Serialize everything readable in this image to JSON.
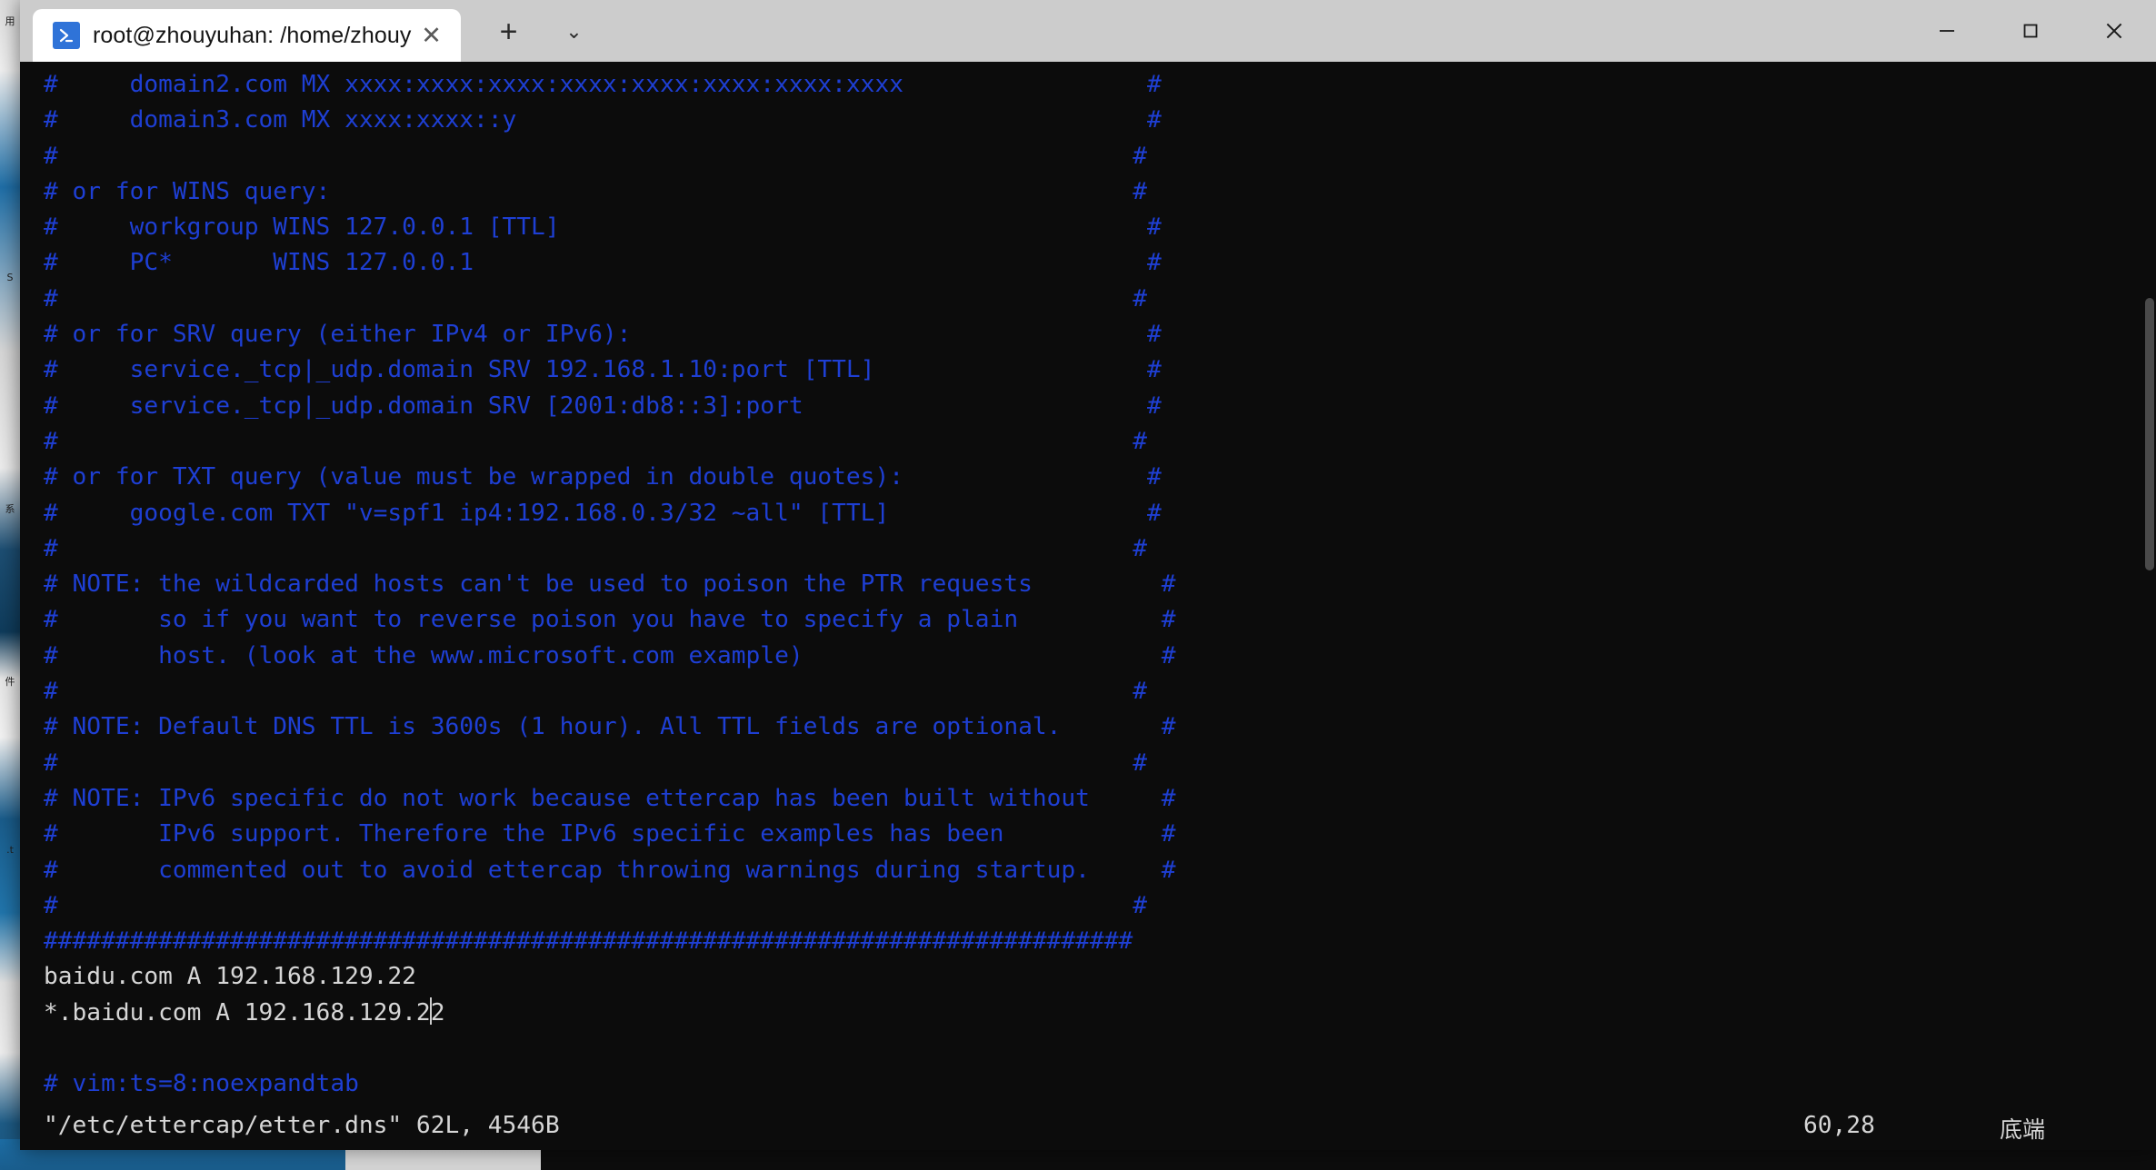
{
  "window": {
    "tab": {
      "title": "root@zhouyuhan: /home/zhouy",
      "icon": "powershell-icon",
      "close_label": "✕"
    },
    "newtab_label": "+",
    "dropdown_label": "⌄",
    "controls": {
      "minimize_label": "─",
      "maximize_label": "□",
      "close_label": "✕"
    }
  },
  "terminal": {
    "fg_comment": "#1e3fd4",
    "fg_text": "#d6d6d6",
    "background": "#0c0c0c",
    "lines": [
      {
        "text": "#     domain2.com MX xxxx:xxxx:xxxx:xxxx:xxxx:xxxx:xxxx:xxxx                 #",
        "style": "comment"
      },
      {
        "text": "#     domain3.com MX xxxx:xxxx::y                                            #",
        "style": "comment"
      },
      {
        "text": "#                                                                           #",
        "style": "comment"
      },
      {
        "text": "# or for WINS query:                                                        #",
        "style": "comment"
      },
      {
        "text": "#     workgroup WINS 127.0.0.1 [TTL]                                         #",
        "style": "comment"
      },
      {
        "text": "#     PC*       WINS 127.0.0.1                                               #",
        "style": "comment"
      },
      {
        "text": "#                                                                           #",
        "style": "comment"
      },
      {
        "text": "# or for SRV query (either IPv4 or IPv6):                                    #",
        "style": "comment"
      },
      {
        "text": "#     service._tcp|_udp.domain SRV 192.168.1.10:port [TTL]                   #",
        "style": "comment"
      },
      {
        "text": "#     service._tcp|_udp.domain SRV [2001:db8::3]:port                        #",
        "style": "comment"
      },
      {
        "text": "#                                                                           #",
        "style": "comment"
      },
      {
        "text": "# or for TXT query (value must be wrapped in double quotes):                 #",
        "style": "comment"
      },
      {
        "text": "#     google.com TXT \"v=spf1 ip4:192.168.0.3/32 ~all\" [TTL]                  #",
        "style": "comment"
      },
      {
        "text": "#                                                                           #",
        "style": "comment"
      },
      {
        "text": "# NOTE: the wildcarded hosts can't be used to poison the PTR requests         #",
        "style": "comment"
      },
      {
        "text": "#       so if you want to reverse poison you have to specify a plain          #",
        "style": "comment"
      },
      {
        "text": "#       host. (look at the www.microsoft.com example)                         #",
        "style": "comment"
      },
      {
        "text": "#                                                                           #",
        "style": "comment"
      },
      {
        "text": "# NOTE: Default DNS TTL is 3600s (1 hour). All TTL fields are optional.       #",
        "style": "comment"
      },
      {
        "text": "#                                                                           #",
        "style": "comment"
      },
      {
        "text": "# NOTE: IPv6 specific do not work because ettercap has been built without     #",
        "style": "comment"
      },
      {
        "text": "#       IPv6 support. Therefore the IPv6 specific examples has been           #",
        "style": "comment"
      },
      {
        "text": "#       commented out to avoid ettercap throwing warnings during startup.     #",
        "style": "comment"
      },
      {
        "text": "#                                                                           #",
        "style": "comment"
      },
      {
        "text": "############################################################################",
        "style": "comment"
      },
      {
        "text": "baidu.com A 192.168.129.22",
        "style": "text"
      },
      {
        "text": "*.baidu.com A 192.168.129.2|2",
        "style": "text-cursor"
      },
      {
        "text": "",
        "style": "text"
      },
      {
        "text": "# vim:ts=8:noexpandtab",
        "style": "comment"
      }
    ],
    "statusline": {
      "file": "\"/etc/ettercap/etter.dns\" 62L, 4546B",
      "position": "60,28",
      "mode": "底端"
    }
  },
  "desktop": {
    "left_strip_glyphs": [
      "用",
      "S",
      "系",
      "件",
      ".t"
    ]
  }
}
